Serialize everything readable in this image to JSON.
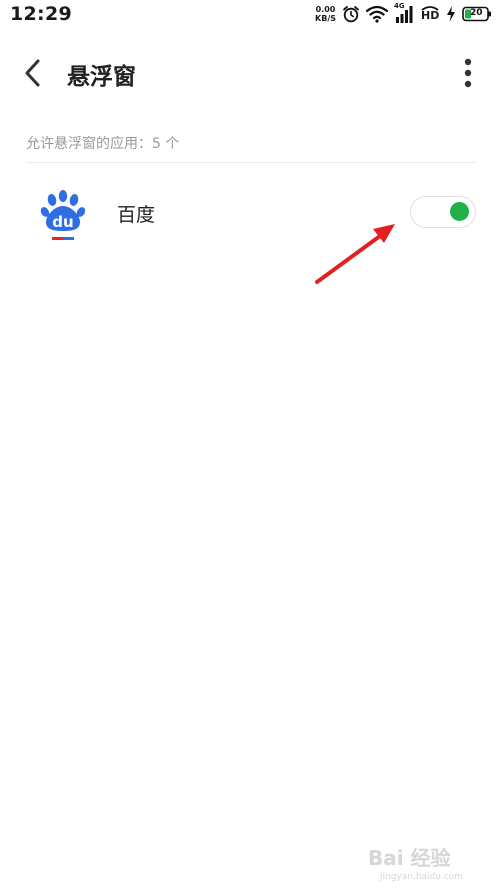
{
  "status_bar": {
    "time": "12:29",
    "net_speed_value": "0.00",
    "net_speed_unit": "KB/S",
    "network_type": "4G",
    "hd_label": "HD",
    "battery_level": "20"
  },
  "header": {
    "title": "悬浮窗"
  },
  "section": {
    "label": "允许悬浮窗的应用：5 个"
  },
  "apps": [
    {
      "name": "百度",
      "icon": "baidu-paw-icon",
      "icon_text": "du",
      "enabled": true
    }
  ],
  "colors": {
    "toggle_on": "#21b14b",
    "baidu_blue": "#2f6ee3",
    "baidu_red": "#e0262d",
    "annotation_arrow": "#e32020",
    "section_text": "#9a9a9a"
  },
  "watermark": {
    "text": "Bai 经验",
    "subtext": "jingyan.baidu.com"
  }
}
